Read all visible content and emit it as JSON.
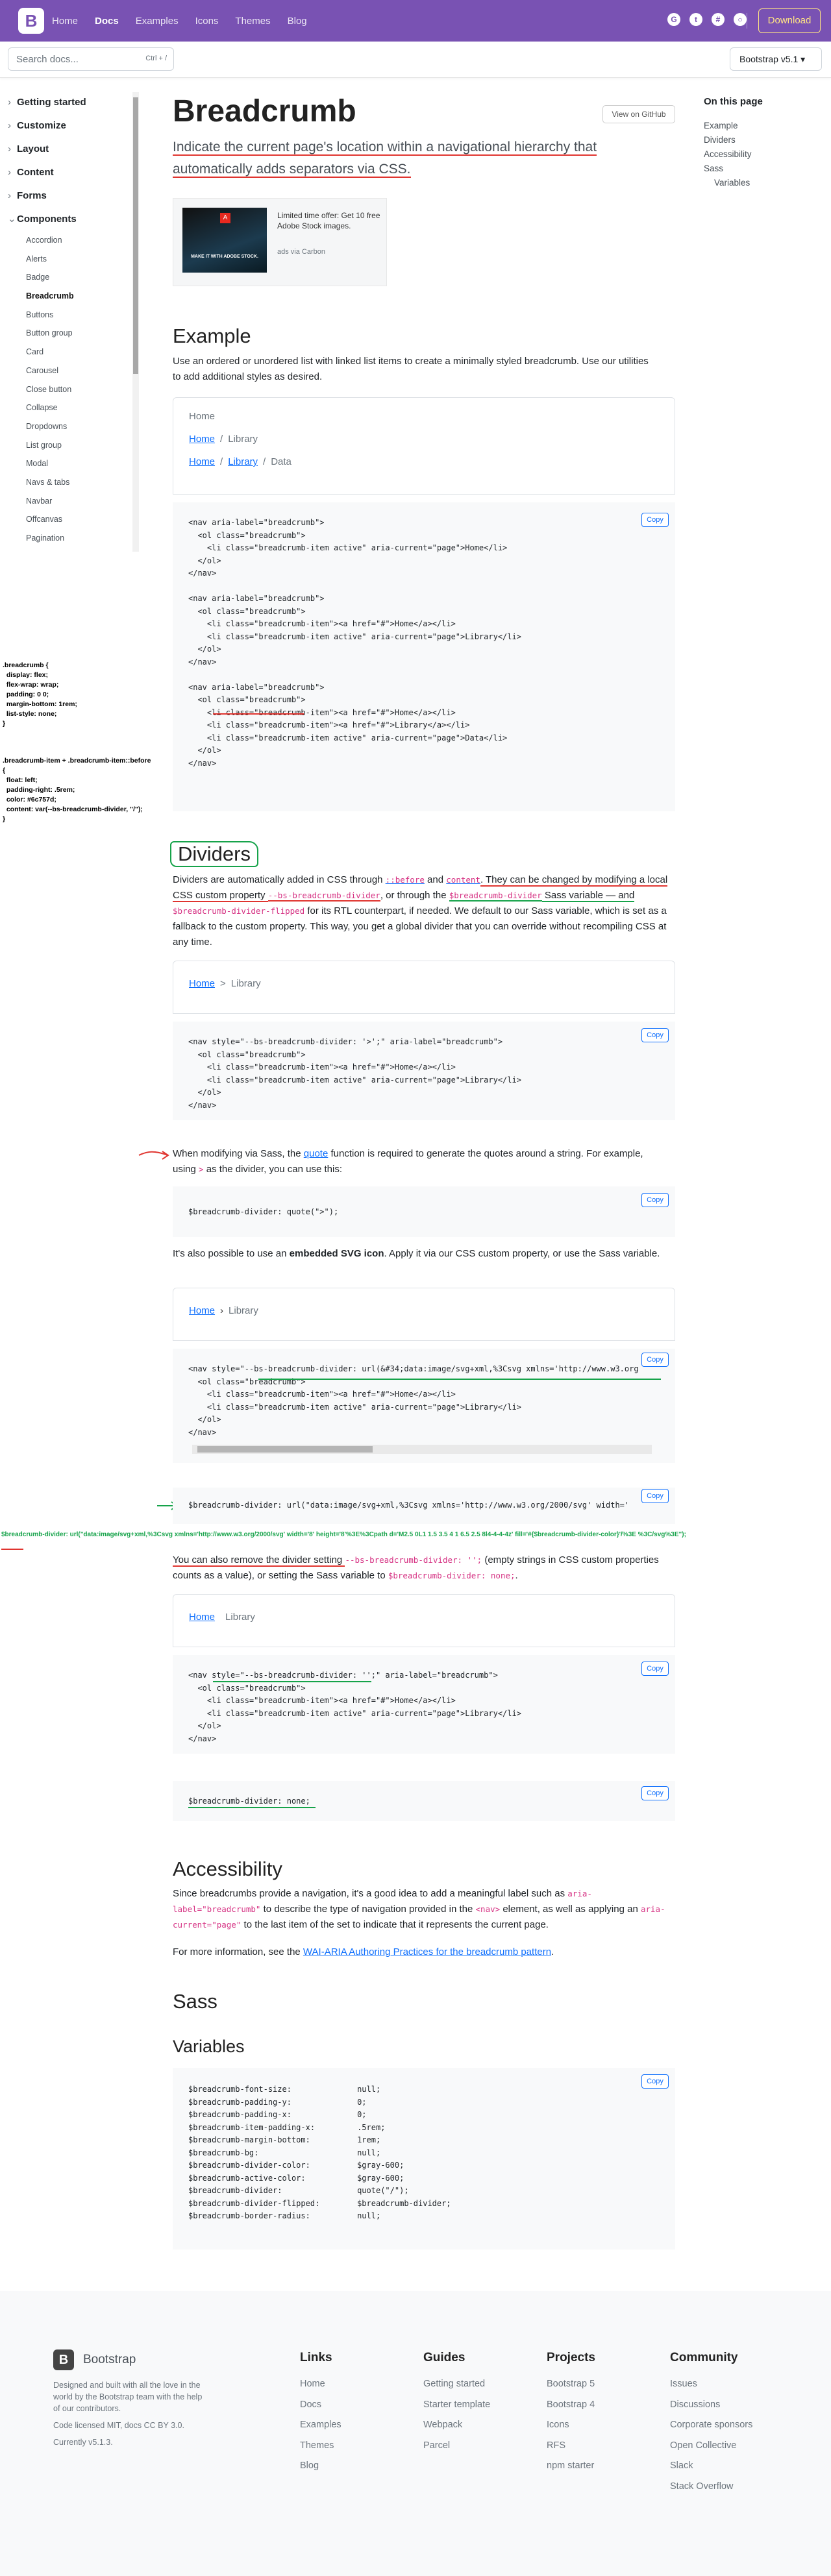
{
  "navbar": {
    "brand": "B",
    "links": [
      "Home",
      "Docs",
      "Examples",
      "Icons",
      "Themes",
      "Blog"
    ],
    "active": "Docs",
    "icons": [
      "github-icon",
      "twitter-icon",
      "slack-icon",
      "opencollective-icon"
    ],
    "download": "Download"
  },
  "subnav": {
    "search_placeholder": "Search docs...",
    "search_shortcut": "Ctrl + /",
    "version": "Bootstrap v5.1 ▾"
  },
  "sidebar": {
    "groups": [
      {
        "label": "Getting started",
        "chev": "›"
      },
      {
        "label": "Customize",
        "chev": "›"
      },
      {
        "label": "Layout",
        "chev": "›"
      },
      {
        "label": "Content",
        "chev": "›"
      },
      {
        "label": "Forms",
        "chev": "›"
      },
      {
        "label": "Components",
        "chev": "⌄"
      }
    ],
    "items": [
      "Accordion",
      "Alerts",
      "Badge",
      "Breadcrumb",
      "Buttons",
      "Button group",
      "Card",
      "Carousel",
      "Close button",
      "Collapse",
      "Dropdowns",
      "List group",
      "Modal",
      "Navs & tabs",
      "Navbar",
      "Offcanvas",
      "Pagination"
    ],
    "active_item": "Breadcrumb"
  },
  "toc": {
    "heading": "On this page",
    "items": [
      "Example",
      "Dividers",
      "Accessibility",
      "Sass"
    ],
    "sub_items": [
      "Variables"
    ]
  },
  "main": {
    "title": "Breadcrumb",
    "view_github": "View on GitHub",
    "lead": "Indicate the current page's location within a navigational hierarchy that automatically adds separators via CSS.",
    "ad": {
      "logo": "A",
      "text": "Limited time offer: Get 10 free Adobe Stock images.",
      "via": "ads via Carbon",
      "img_caption": "MAKE IT WITH ADOBE STOCK."
    },
    "example": {
      "heading": "Example",
      "desc": "Use an ordered or unordered list with linked list items to create a minimally styled breadcrumb. Use our utilities to add additional styles as desired.",
      "crumbs": [
        [
          "Home"
        ],
        [
          "Home",
          "Library"
        ],
        [
          "Home",
          "Library",
          "Data"
        ]
      ]
    },
    "dividers": {
      "heading": "Dividers",
      "p1_a": "Dividers are automatically added in CSS through ",
      "p1_before": "::before",
      "p1_b": " and ",
      "p1_content": "content",
      "p1_c": ". They can be changed by modifying a local CSS custom property ",
      "p1_var": "--bs-breadcrumb-divider",
      "p1_d": ", or through the ",
      "p1_sass": "$breadcrumb-divider",
      "p1_e": " Sass variable — and ",
      "p1_flip": "$breadcrumb-divider-flipped",
      "p1_f": " for its RTL counterpart, if needed. We default to our Sass variable, which is set as a fallback to the custom property. This way, you get a global divider that you can override without recompiling CSS at any time.",
      "p2_a": "When modifying via Sass, the ",
      "p2_quote": "quote",
      "p2_b": " function is required to generate the quotes around a string. For example, using ",
      "p2_gt": ">",
      "p2_c": " as the divider, you can use this:",
      "p3_a": "It's also possible to use an ",
      "p3_b": "embedded SVG icon",
      "p3_c": ". Apply it via our CSS custom property, or use the Sass variable.",
      "p4_a": "You can also remove the divider setting ",
      "p4_code": "--bs-breadcrumb-divider: '';",
      "p4_b": " (empty strings in CSS custom properties counts as a value), or setting the Sass variable to ",
      "p4_code2": "$breadcrumb-divider: none;",
      "p4_c": "."
    },
    "accessibility": {
      "heading": "Accessibility",
      "p1_a": "Since breadcrumbs provide a navigation, it's a good idea to add a meaningful label such as ",
      "p1_code": "aria-label=\"breadcrumb\"",
      "p1_b": " to describe the type of navigation provided in the ",
      "p1_nav": "<nav>",
      "p1_c": " element, as well as applying an ",
      "p1_code2": "aria-current=\"page\"",
      "p1_d": " to the last item of the set to indicate that it represents the current page.",
      "p2_a": "For more information, see the ",
      "p2_link": "WAI-ARIA Authoring Practices for the breadcrumb pattern",
      "p2_b": "."
    },
    "sass_heading": "Sass",
    "variables_heading": "Variables",
    "copy_label": "Copy"
  },
  "code": {
    "example": "<nav aria-label=\"breadcrumb\">\n  <ol class=\"breadcrumb\">\n    <li class=\"breadcrumb-item active\" aria-current=\"page\">Home</li>\n  </ol>\n</nav>\n\n<nav aria-label=\"breadcrumb\">\n  <ol class=\"breadcrumb\">\n    <li class=\"breadcrumb-item\"><a href=\"#\">Home</a></li>\n    <li class=\"breadcrumb-item active\" aria-current=\"page\">Library</li>\n  </ol>\n</nav>\n\n<nav aria-label=\"breadcrumb\">\n  <ol class=\"breadcrumb\">\n    <li class=\"breadcrumb-item\"><a href=\"#\">Home</a></li>\n    <li class=\"breadcrumb-item\"><a href=\"#\">Library</a></li>\n    <li class=\"breadcrumb-item active\" aria-current=\"page\">Data</li>\n  </ol>\n</nav>",
    "divider_gt": "<nav style=\"--bs-breadcrumb-divider: '>';\" aria-label=\"breadcrumb\">\n  <ol class=\"breadcrumb\">\n    <li class=\"breadcrumb-item\"><a href=\"#\">Home</a></li>\n    <li class=\"breadcrumb-item active\" aria-current=\"page\">Library</li>\n  </ol>\n</nav>",
    "sass_quote": "$breadcrumb-divider: quote(\">\");",
    "svg_html": "<nav style=\"--bs-breadcrumb-divider: url(&#34;data:image/svg+xml,%3Csvg xmlns='http://www.w3.org\n  <ol class=\"breadcrumb\">\n    <li class=\"breadcrumb-item\"><a href=\"#\">Home</a></li>\n    <li class=\"breadcrumb-item active\" aria-current=\"page\">Library</li>\n  </ol>\n</nav>",
    "svg_sass": "$breadcrumb-divider: url(\"data:image/svg+xml,%3Csvg xmlns='http://www.w3.org/2000/svg' width='",
    "empty_html": "<nav style=\"--bs-breadcrumb-divider: '';\" aria-label=\"breadcrumb\">\n  <ol class=\"breadcrumb\">\n    <li class=\"breadcrumb-item\"><a href=\"#\">Home</a></li>\n    <li class=\"breadcrumb-item active\" aria-current=\"page\">Library</li>\n  </ol>\n</nav>",
    "none_sass": "$breadcrumb-divider: none;",
    "variables": "$breadcrumb-font-size:              null;\n$breadcrumb-padding-y:              0;\n$breadcrumb-padding-x:              0;\n$breadcrumb-item-padding-x:         .5rem;\n$breadcrumb-margin-bottom:          1rem;\n$breadcrumb-bg:                     null;\n$breadcrumb-divider-color:          $gray-600;\n$breadcrumb-active-color:           $gray-600;\n$breadcrumb-divider:                quote(\"/\");\n$breadcrumb-divider-flipped:        $breadcrumb-divider;\n$breadcrumb-border-radius:          null;"
  },
  "notes": {
    "css1": ".breadcrumb {\n  display: flex;\n  flex-wrap: wrap;\n  padding: 0 0;\n  margin-bottom: 1rem;\n  list-style: none;\n}",
    "css2": ".breadcrumb-item + .breadcrumb-item::before\n{\n  float: left;\n  padding-right: .5rem;\n  color: #6c757d;\n  content: var(--bs-breadcrumb-divider, \"/\");\n}",
    "svg_note": "$breadcrumb-divider: url(\"data:image/svg+xml,%3Csvg xmlns='http://www.w3.org/2000/svg' width='8' height='8'%3E%3Cpath d='M2.5 0L1 1.5 3.5 4 1 6.5 2.5 8l4-4-4-4z' fill='#{$breadcrumb-divider-color}'/%3E\n%3C/svg%3E\");"
  },
  "footer": {
    "brand": "Bootstrap",
    "desc": "Designed and built with all the love in the world by the Bootstrap team with the help of our contributors.",
    "license": "Code licensed MIT, docs CC BY 3.0.",
    "version": "Currently v5.1.3.",
    "columns": [
      {
        "heading": "Links",
        "items": [
          "Home",
          "Docs",
          "Examples",
          "Themes",
          "Blog"
        ]
      },
      {
        "heading": "Guides",
        "items": [
          "Getting started",
          "Starter template",
          "Webpack",
          "Parcel"
        ]
      },
      {
        "heading": "Projects",
        "items": [
          "Bootstrap 5",
          "Bootstrap 4",
          "Icons",
          "RFS",
          "npm starter"
        ]
      },
      {
        "heading": "Community",
        "items": [
          "Issues",
          "Discussions",
          "Corporate sponsors",
          "Open Collective",
          "Slack",
          "Stack Overflow"
        ]
      }
    ]
  },
  "colors": {
    "brand": "#7952b3",
    "link": "#0d6efd",
    "code": "#d63384",
    "annotation_red": "#e0342f",
    "annotation_green": "#16a34a",
    "annotation_blue": "#1d4ed8"
  }
}
